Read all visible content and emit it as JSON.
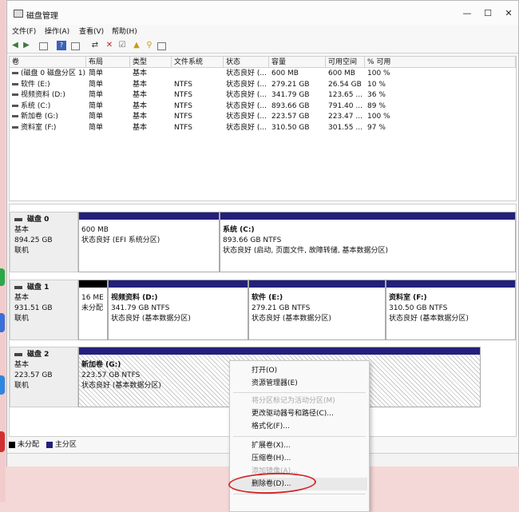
{
  "window": {
    "title": "磁盘管理",
    "minimize": "—",
    "maximize": "☐",
    "close": "✕"
  },
  "menu": [
    "文件(F)",
    "操作(A)",
    "查看(V)",
    "帮助(H)"
  ],
  "volume_table": {
    "headers": [
      "卷",
      "布局",
      "类型",
      "文件系统",
      "状态",
      "容量",
      "可用空间",
      "% 可用"
    ],
    "rows": [
      [
        "(磁盘 0 磁盘分区 1)",
        "简单",
        "基本",
        "",
        "状态良好 (...",
        "600 MB",
        "600 MB",
        "100 %"
      ],
      [
        "软件 (E:)",
        "简单",
        "基本",
        "NTFS",
        "状态良好 (...",
        "279.21 GB",
        "26.54 GB",
        "10 %"
      ],
      [
        "视频资料 (D:)",
        "简单",
        "基本",
        "NTFS",
        "状态良好 (...",
        "341.79 GB",
        "123.65 ...",
        "36 %"
      ],
      [
        "系统 (C:)",
        "简单",
        "基本",
        "NTFS",
        "状态良好 (...",
        "893.66 GB",
        "791.40 ...",
        "89 %"
      ],
      [
        "新加卷 (G:)",
        "简单",
        "基本",
        "NTFS",
        "状态良好 (...",
        "223.57 GB",
        "223.47 ...",
        "100 %"
      ],
      [
        "资料室 (F:)",
        "简单",
        "基本",
        "NTFS",
        "状态良好 (...",
        "310.50 GB",
        "301.55 ...",
        "97 %"
      ]
    ]
  },
  "disks": [
    {
      "name": "磁盘 0",
      "type": "基本",
      "size": "894.25 GB",
      "status": "联机",
      "partitions": [
        {
          "name": "",
          "size": "600 MB",
          "status": "状态良好 (EFI 系统分区)"
        },
        {
          "name": "系统 (C:)",
          "size": "893.66 GB NTFS",
          "status": "状态良好 (启动, 页面文件, 故障转储, 基本数据分区)"
        }
      ]
    },
    {
      "name": "磁盘 1",
      "type": "基本",
      "size": "931.51 GB",
      "status": "联机",
      "partitions": [
        {
          "name": "",
          "size": "16 ME",
          "status": "未分配"
        },
        {
          "name": "视频资料 (D:)",
          "size": "341.79 GB NTFS",
          "status": "状态良好 (基本数据分区)"
        },
        {
          "name": "软件 (E:)",
          "size": "279.21 GB NTFS",
          "status": "状态良好 (基本数据分区)"
        },
        {
          "name": "资料室 (F:)",
          "size": "310.50 GB NTFS",
          "status": "状态良好 (基本数据分区)"
        }
      ]
    },
    {
      "name": "磁盘 2",
      "type": "基本",
      "size": "223.57 GB",
      "status": "联机",
      "partitions": [
        {
          "name": "新加卷 (G:)",
          "size": "223.57 GB NTFS",
          "status": "状态良好 (基本数据分区)"
        }
      ]
    }
  ],
  "legend": {
    "unallocated": "未分配",
    "primary": "主分区",
    "unallocated_color": "#000000",
    "primary_color": "#22207b"
  },
  "context_menu": {
    "items": [
      {
        "label": "打开(O)",
        "enabled": true
      },
      {
        "label": "资源管理器(E)",
        "enabled": true
      },
      {
        "label": "将分区标记为活动分区(M)",
        "enabled": false
      },
      {
        "label": "更改驱动器号和路径(C)...",
        "enabled": true
      },
      {
        "label": "格式化(F)...",
        "enabled": true
      },
      {
        "label": "扩展卷(X)...",
        "enabled": true
      },
      {
        "label": "压缩卷(H)...",
        "enabled": true
      },
      {
        "label": "添加镜像(A)...",
        "enabled": false
      },
      {
        "label": "删除卷(D)...",
        "enabled": true
      }
    ],
    "highlighted": "删除卷(D)...",
    "highlight_color": "#d22b2b"
  }
}
